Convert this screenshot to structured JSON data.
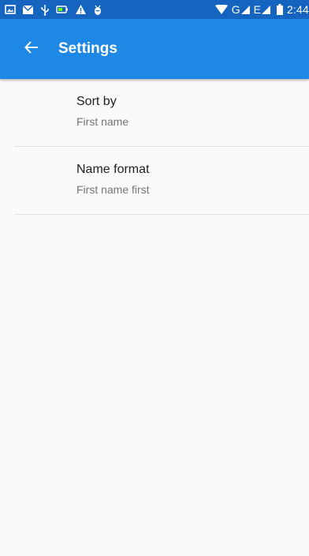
{
  "status_bar": {
    "left_icons": [
      "picture-icon",
      "mail-icon",
      "usb-icon",
      "battery-saver-icon",
      "warning-icon",
      "android-debug-icon"
    ],
    "signal_text_1": "G",
    "signal_text_2": "E",
    "time": "2:44"
  },
  "app_bar": {
    "title": "Settings",
    "back_icon": "arrow-back-icon",
    "color": "#1e88e5"
  },
  "settings": [
    {
      "primary": "Sort by",
      "secondary": "First name"
    },
    {
      "primary": "Name format",
      "secondary": "First name first"
    }
  ]
}
